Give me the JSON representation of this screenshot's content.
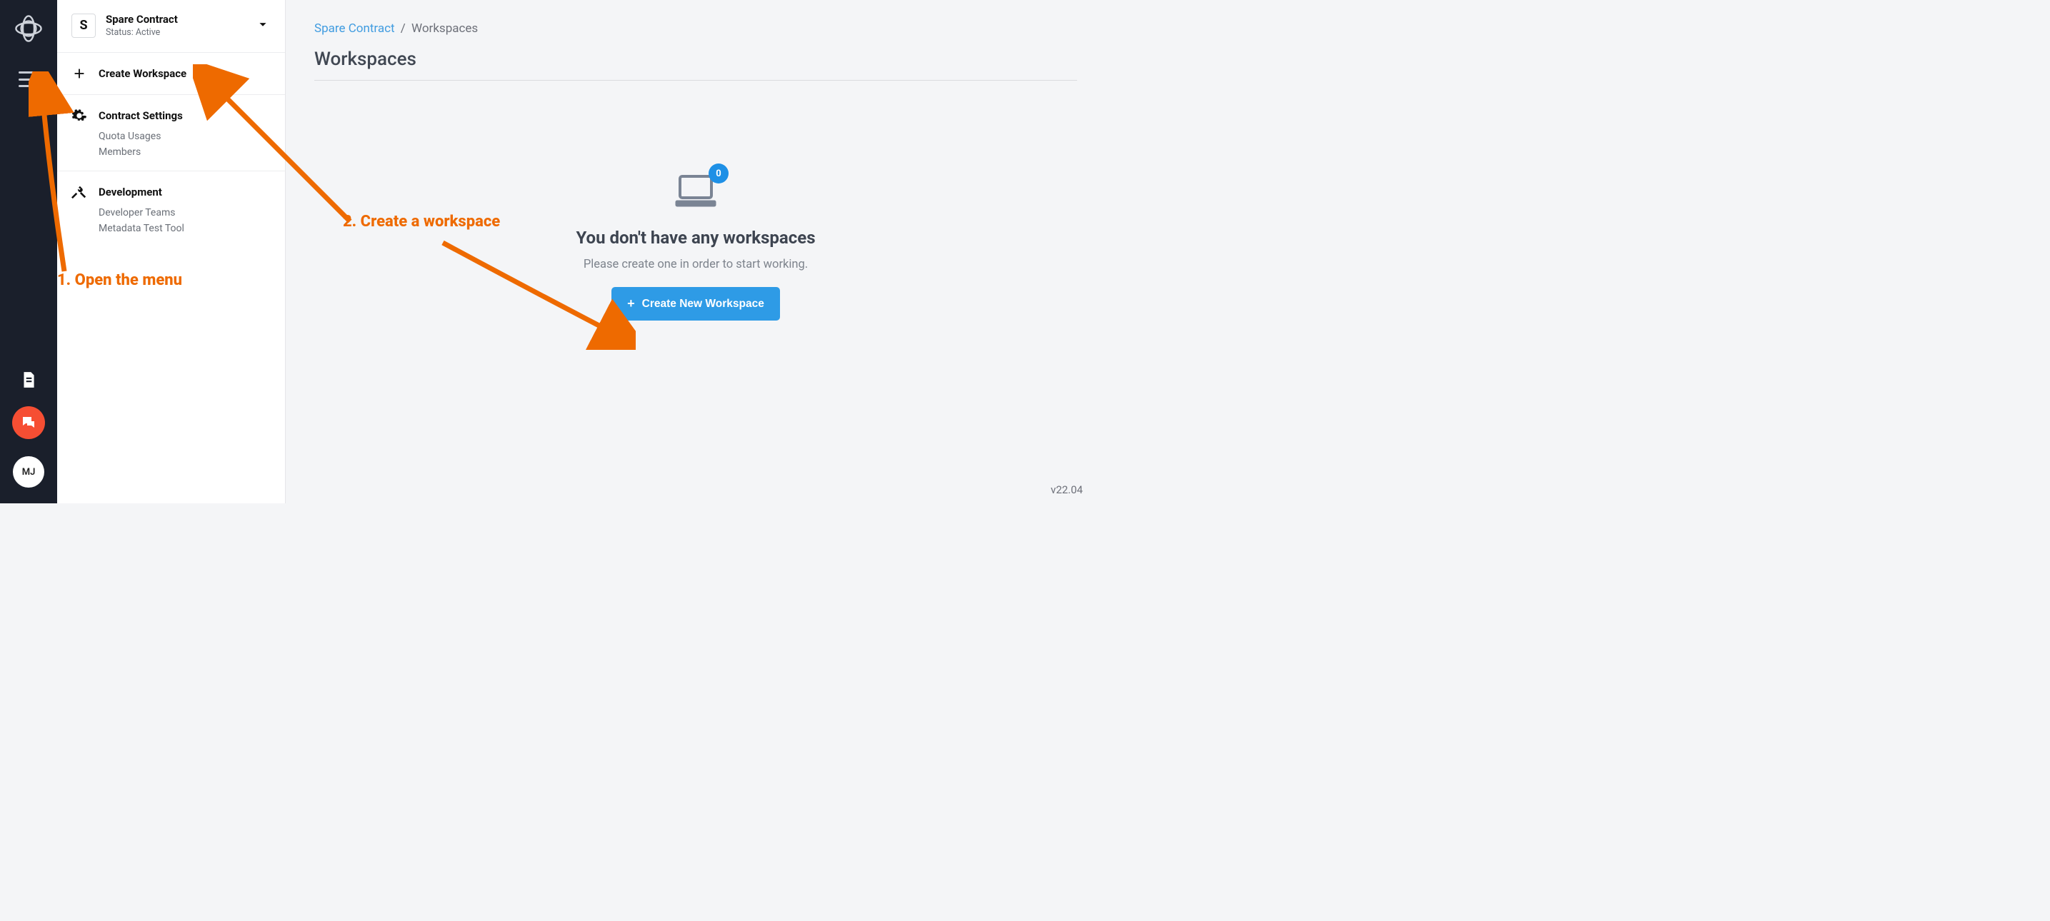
{
  "rail": {
    "avatar_initials": "MJ"
  },
  "sidebar": {
    "contract": {
      "badge": "S",
      "name": "Spare Contract",
      "status": "Status: Active"
    },
    "create_workspace": "Create Workspace",
    "settings": {
      "title": "Contract Settings",
      "items": [
        "Quota Usages",
        "Members"
      ]
    },
    "development": {
      "title": "Development",
      "items": [
        "Developer Teams",
        "Metadata Test Tool"
      ]
    }
  },
  "breadcrumb": {
    "root": "Spare Contract",
    "sep": "/",
    "current": "Workspaces"
  },
  "page_title": "Workspaces",
  "empty": {
    "badge": "0",
    "heading": "You don't have any workspaces",
    "subtext": "Please create one in order to start working.",
    "button": "Create New Workspace"
  },
  "version": "v22.04",
  "annotations": {
    "step1": "1. Open the menu",
    "step2": "2. Create a workspace"
  }
}
